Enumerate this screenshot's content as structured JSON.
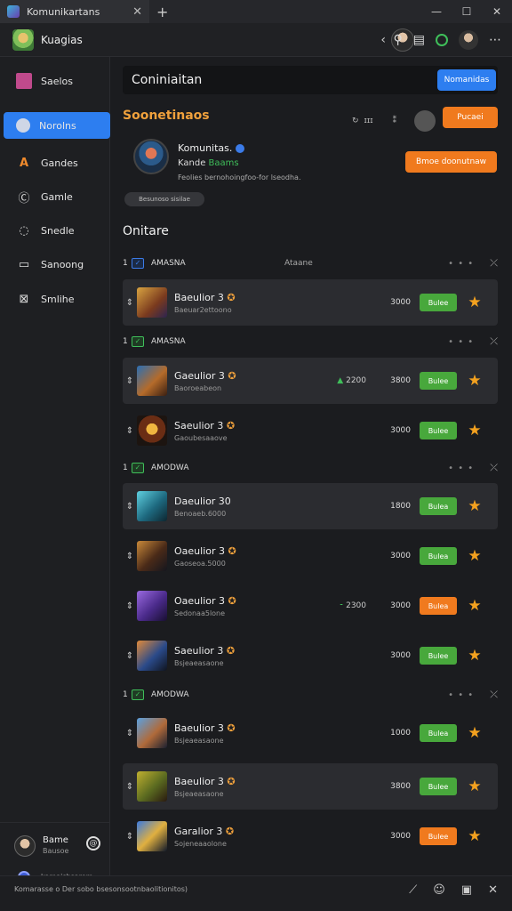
{
  "window": {
    "tab_title": "Komunikartans",
    "new_tab": "+",
    "controls": [
      "—",
      "☐",
      "✕"
    ]
  },
  "header": {
    "title": "Kuagias",
    "back": "‹"
  },
  "sidebar": {
    "items": [
      {
        "label": "Saelos",
        "icon": "book-icon"
      },
      {
        "label": "Norolns",
        "icon": "user-icon"
      },
      {
        "label": "Gandes",
        "icon": "ai-icon"
      },
      {
        "label": "Gamle",
        "icon": "circle-c-icon"
      },
      {
        "label": "Snedle",
        "icon": "chat-icon"
      },
      {
        "label": "Sanoong",
        "icon": "document-icon"
      },
      {
        "label": "Smlihe",
        "icon": "crop-icon"
      }
    ],
    "footer": {
      "name": "Bame",
      "sub": "Bausoe",
      "small": "kamaisbsarem"
    }
  },
  "main": {
    "search_text": "Coniniaitan",
    "search_button": "Nomanidas",
    "section_title": "Soonetinaos",
    "tools": {
      "a": "ɪɪɪ",
      "b": "⁑"
    },
    "top_button": "Pucaei",
    "community": {
      "name": "Komunitas.",
      "sub_a": "Kande",
      "sub_b": "Baams",
      "desc": "Feolies bernohoingfoo-for lseodha.",
      "join_button": "Bmoe doonutnaw",
      "chip": "Besunoso sisilae"
    },
    "online_heading": "Onitare"
  },
  "groups": [
    {
      "num": "1",
      "name": "AMASNA",
      "extra": "Ataane",
      "checkbox": "blue",
      "rows": [
        {
          "name": "Baeulior 3",
          "sub": "Baeuar2ettoono",
          "stat": "",
          "value": "3000",
          "button": "Bulee",
          "button_color": "g",
          "highlight": true
        }
      ]
    },
    {
      "num": "1",
      "name": "AMASNA",
      "extra": "",
      "checkbox": "green",
      "rows": [
        {
          "name": "Gaeulior 3",
          "sub": "Baoroeabeon",
          "stat": "2200",
          "value": "3800",
          "button": "Bulee",
          "button_color": "g",
          "highlight": true
        },
        {
          "name": "Saeulior 3",
          "sub": "Gaoubesaaove",
          "stat": "",
          "value": "3000",
          "button": "Bulee",
          "button_color": "g",
          "highlight": false
        }
      ]
    },
    {
      "num": "1",
      "name": "AMODWA",
      "extra": "",
      "checkbox": "green",
      "rows": [
        {
          "name": "Daeulior 30",
          "sub": "Benoaeb.6000",
          "stat": "",
          "value": "1800",
          "button": "Bulea",
          "button_color": "g",
          "highlight": true
        },
        {
          "name": "Oaeulior 3",
          "sub": "Gaoseoa.5000",
          "stat": "",
          "value": "3000",
          "button": "Bulea",
          "button_color": "g",
          "highlight": false
        },
        {
          "name": "Oaeulior 3",
          "sub": "Sedonaa5lone",
          "stat": "2300",
          "value": "3000",
          "button": "Bulea",
          "button_color": "o",
          "highlight": false
        },
        {
          "name": "Saeulior 3",
          "sub": "Bsjeaeasaone",
          "stat": "",
          "value": "3000",
          "button": "Bulee",
          "button_color": "g",
          "highlight": false
        }
      ]
    },
    {
      "num": "1",
      "name": "AMODWA",
      "extra": "",
      "checkbox": "green",
      "rows": [
        {
          "name": "Baeulior 3",
          "sub": "Bsjeaeasaone",
          "stat": "",
          "value": "1000",
          "button": "Bulea",
          "button_color": "g",
          "highlight": false
        },
        {
          "name": "Baeulior 3",
          "sub": "Bsjeaeasaone",
          "stat": "",
          "value": "3800",
          "button": "Bulee",
          "button_color": "g",
          "highlight": true
        },
        {
          "name": "Garalior 3",
          "sub": "Sojeneaaolone",
          "stat": "",
          "value": "3000",
          "button": "Bulee",
          "button_color": "o",
          "highlight": false
        }
      ]
    }
  ],
  "bottom": {
    "text": "Komarasse o Der sobo bsesonsootnbaolitionitos)"
  },
  "colors": {
    "accent_blue": "#2d7ef0",
    "accent_orange": "#f07a1e",
    "green": "#48a83c",
    "title_orange": "#f0a13c"
  }
}
